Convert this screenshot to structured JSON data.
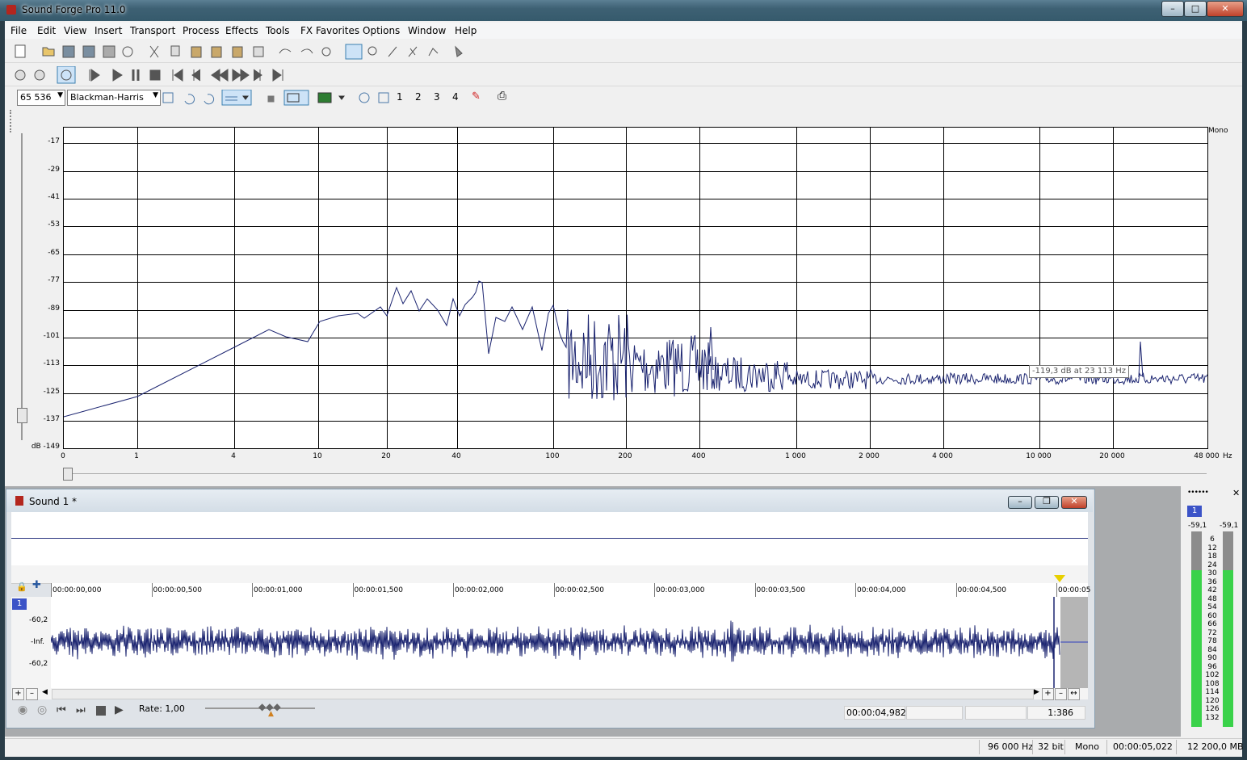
{
  "window": {
    "title": "Sound Forge Pro 11.0"
  },
  "menu": [
    "File",
    "Edit",
    "View",
    "Insert",
    "Transport",
    "Process",
    "Effects",
    "Tools",
    "FX Favorites",
    "Options",
    "Window",
    "Help"
  ],
  "spectrum_toolbar": {
    "fft_size": "65 536",
    "window_function": "Blackman-Harris",
    "snapshots": [
      "1",
      "2",
      "3",
      "4"
    ]
  },
  "spectrum": {
    "channel_label": "Mono",
    "y_unit": "dB",
    "y_ticks": [
      "-17",
      "-29",
      "-41",
      "-53",
      "-65",
      "-77",
      "-89",
      "-101",
      "-113",
      "-125",
      "-137",
      "-149"
    ],
    "x_unit": "Hz",
    "x_ticks": [
      "0",
      "1",
      "4",
      "10",
      "20",
      "40",
      "100",
      "200",
      "400",
      "1 000",
      "2 000",
      "4 000",
      "10 000",
      "20 000",
      "48 000"
    ],
    "tooltip": "-119,3 dB at 23 113 Hz"
  },
  "sound_window": {
    "title": "Sound 1 *",
    "channel_number": "1",
    "ruler_labels": [
      "00:00:00,000",
      "00:00:00,500",
      "00:00:01,000",
      "00:00:01,500",
      "00:00:02,000",
      "00:00:02,500",
      "00:00:03,000",
      "00:00:03,500",
      "00:00:04,000",
      "00:00:04,500",
      "00:00:05"
    ],
    "level_labels": [
      "-60,2",
      "-Inf.",
      "-60,2"
    ],
    "rate_label": "Rate: 1,00",
    "position": "00:00:04,982",
    "zoom": "1:386"
  },
  "meters": {
    "channel": "1",
    "peak_left": "-59,1",
    "peak_right": "-59,1",
    "scale": [
      "6",
      "12",
      "18",
      "24",
      "30",
      "36",
      "42",
      "48",
      "54",
      "60",
      "66",
      "72",
      "78",
      "84",
      "90",
      "96",
      "102",
      "108",
      "114",
      "120",
      "126",
      "132"
    ],
    "level_fraction": 0.8
  },
  "status": {
    "sample_rate": "96 000 Hz",
    "bit_depth": "32 bit",
    "channels": "Mono",
    "length": "00:00:05,022",
    "free_space": "12 200,0 MB"
  }
}
